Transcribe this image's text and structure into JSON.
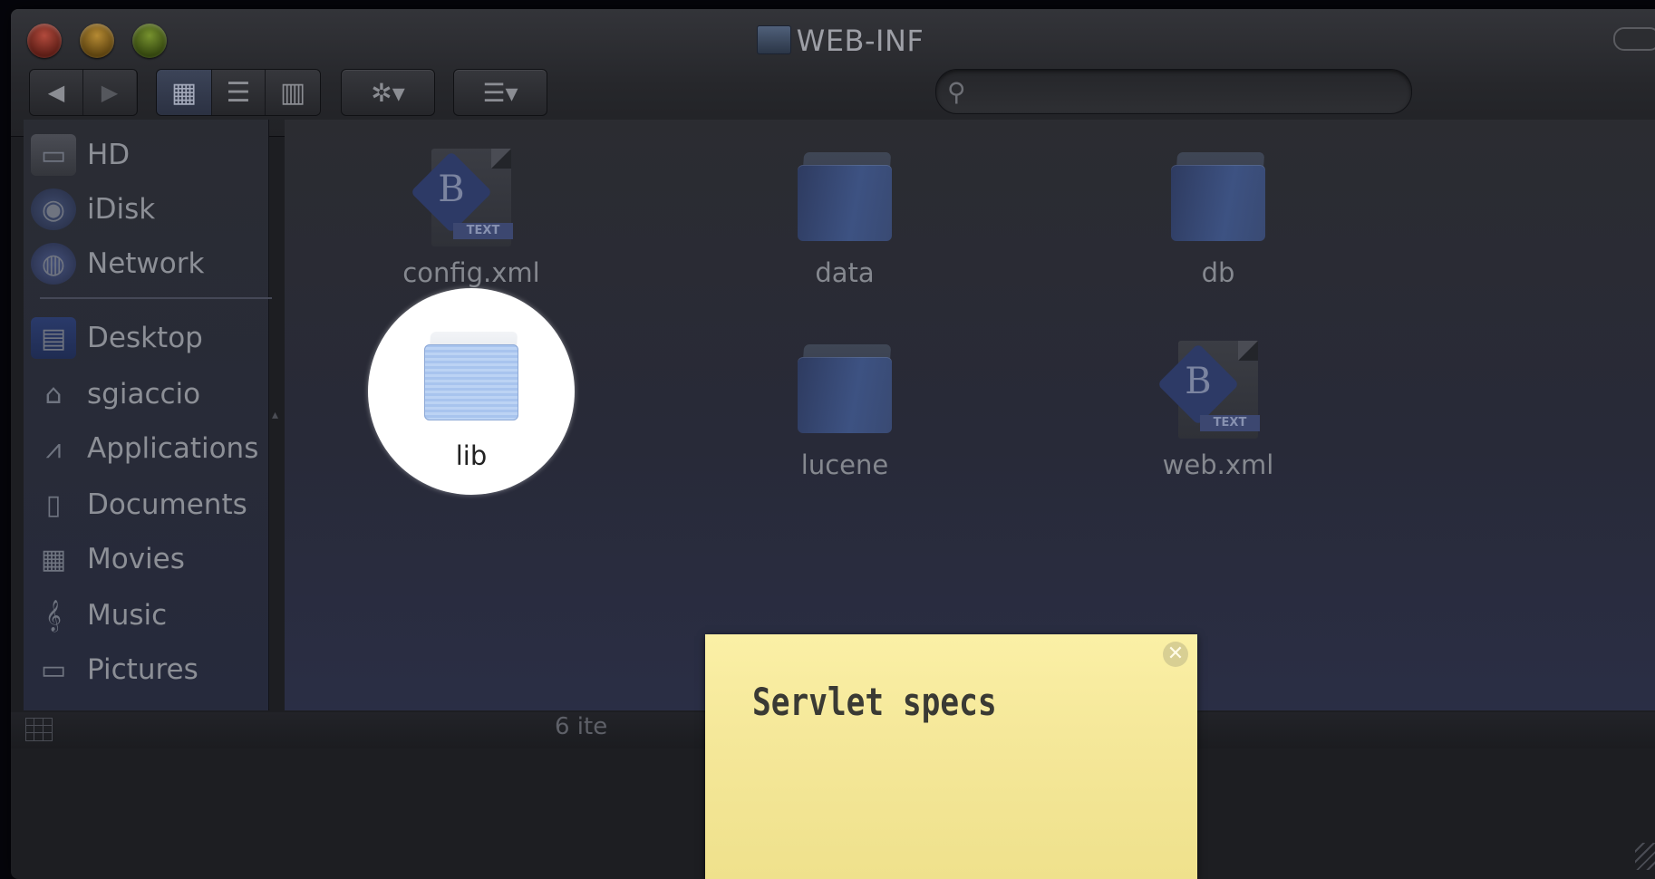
{
  "window": {
    "title": "WEB-INF",
    "status_text": "6 ite"
  },
  "toolbar": {
    "back_glyph": "◀",
    "forward_glyph": "▶",
    "view_icons_glyph": "▦",
    "view_list_glyph": "☰",
    "view_columns_glyph": "▥",
    "action_glyph": "✲▾",
    "arrange_glyph": "☰▾",
    "search_glyph": "⚲",
    "search_value": ""
  },
  "sidebar": {
    "devices": [
      {
        "label": "HD",
        "icon": "hard-drive-icon",
        "glyph": "▭"
      },
      {
        "label": "iDisk",
        "icon": "idisk-icon",
        "glyph": "◉"
      },
      {
        "label": "Network",
        "icon": "network-icon",
        "glyph": "◍"
      }
    ],
    "places": [
      {
        "label": "Desktop",
        "icon": "desktop-icon",
        "glyph": "▤"
      },
      {
        "label": "sgiaccio",
        "icon": "home-icon",
        "glyph": "⌂"
      },
      {
        "label": "Applications",
        "icon": "applications-icon",
        "glyph": "⩘"
      },
      {
        "label": "Documents",
        "icon": "documents-icon",
        "glyph": "▯"
      },
      {
        "label": "Movies",
        "icon": "movies-icon",
        "glyph": "▦"
      },
      {
        "label": "Music",
        "icon": "music-icon",
        "glyph": "𝄞"
      },
      {
        "label": "Pictures",
        "icon": "pictures-icon",
        "glyph": "▭"
      }
    ]
  },
  "files": [
    {
      "name": "config.xml",
      "kind": "document",
      "badge": "B",
      "tag": "TEXT"
    },
    {
      "name": "data",
      "kind": "folder"
    },
    {
      "name": "db",
      "kind": "folder"
    },
    {
      "name": "lib",
      "kind": "folder",
      "highlighted": true
    },
    {
      "name": "lucene",
      "kind": "folder"
    },
    {
      "name": "web.xml",
      "kind": "document",
      "badge": "B",
      "tag": "TEXT"
    }
  ],
  "sticky_note": {
    "text": "Servlet specs",
    "close_glyph": "✕"
  },
  "colors": {
    "sticky_yellow": "#f5e89a",
    "highlight": "#ffffff",
    "dim_text": "#85888f"
  }
}
